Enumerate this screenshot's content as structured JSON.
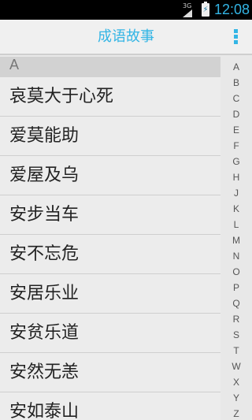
{
  "status_bar": {
    "network": "3G",
    "time": "12:08"
  },
  "action_bar": {
    "title": "成语故事",
    "overflow_icon": "overflow-menu-icon"
  },
  "list": {
    "section": "A",
    "items": [
      "哀莫大于心死",
      "爱莫能助",
      "爱屋及乌",
      "安步当车",
      "安不忘危",
      "安居乐业",
      "安贫乐道",
      "安然无恙",
      "安如泰山"
    ]
  },
  "index_bar": {
    "letters": [
      "A",
      "B",
      "C",
      "D",
      "E",
      "F",
      "G",
      "H",
      "J",
      "K",
      "L",
      "M",
      "N",
      "O",
      "P",
      "Q",
      "R",
      "S",
      "T",
      "W",
      "X",
      "Y",
      "Z"
    ]
  },
  "colors": {
    "accent": "#33b5e5"
  }
}
